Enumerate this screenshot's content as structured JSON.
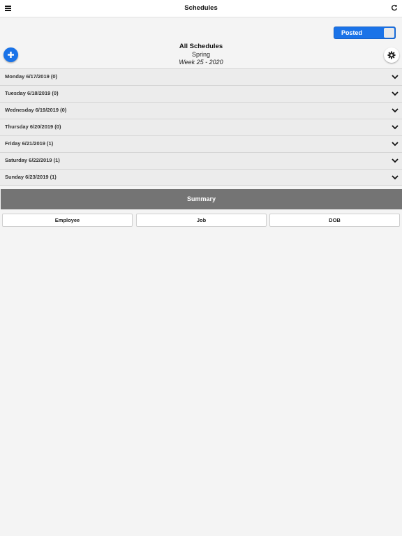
{
  "header": {
    "title": "Schedules",
    "menu_icon": "hamburger-menu-icon",
    "refresh_icon": "refresh-icon"
  },
  "toggle": {
    "label": "Posted",
    "state": "on",
    "color": "#1a73e8"
  },
  "schedule": {
    "title": "All Schedules",
    "season": "Spring",
    "week": "Week 25 - 2020"
  },
  "days": [
    "Monday 6/17/2019 (0)",
    "Tuesday 6/18/2019 (0)",
    "Wednesday 6/19/2019 (0)",
    "Thursday 6/20/2019 (0)",
    "Friday 6/21/2019 (1)",
    "Saturday 6/22/2019 (1)",
    "Sunday 6/23/2019 (1)"
  ],
  "summary": {
    "title": "Summary",
    "tabs": [
      "Employee",
      "Job",
      "DOB"
    ]
  },
  "colors": {
    "accent": "#1a73e8",
    "summary_bar": "#747474",
    "background": "#f4f4f4"
  }
}
